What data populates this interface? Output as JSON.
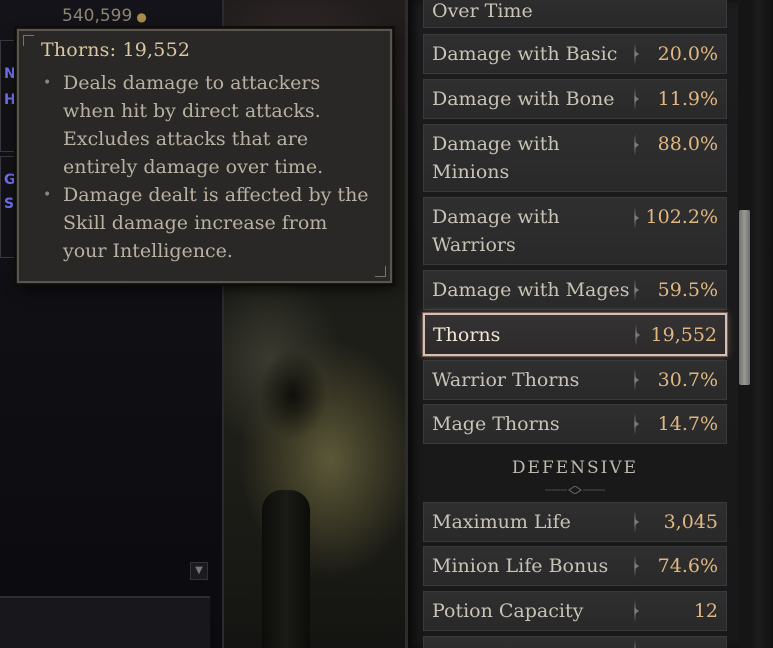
{
  "left_panel": {
    "gold_amount": "540,599",
    "fragment_a": "NG",
    "fragment_b": "HI",
    "fragment_c": "G",
    "fragment_d": "S"
  },
  "tooltip": {
    "title": "Thorns: 19,552",
    "bullets": [
      "Deals damage to attackers when hit by direct attacks. Excludes attacks that are entirely damage over time.",
      "Damage dealt is affected by the Skill damage increase from your Intelligence."
    ]
  },
  "stats": {
    "partial_top_label": "Over Time",
    "rows": [
      {
        "label": "Damage with Basic",
        "value": "20.0%"
      },
      {
        "label": "Damage with Bone",
        "value": "11.9%"
      },
      {
        "label": "Damage with Minions",
        "value": "88.0%"
      },
      {
        "label": "Damage with Warriors",
        "value": "102.2%"
      },
      {
        "label": "Damage with Mages",
        "value": "59.5%"
      },
      {
        "label": "Thorns",
        "value": "19,552"
      },
      {
        "label": "Warrior Thorns",
        "value": "30.7%"
      },
      {
        "label": "Mage Thorns",
        "value": "14.7%"
      }
    ],
    "section_defensive": "DEFENSIVE",
    "defensive_rows": [
      {
        "label": "Maximum Life",
        "value": "3,045"
      },
      {
        "label": "Minion Life Bonus",
        "value": "74.6%"
      },
      {
        "label": "Potion Capacity",
        "value": "12"
      }
    ]
  },
  "colors": {
    "value_gold": "#e0b781",
    "label_text": "#c9c3b5",
    "tooltip_title": "#d8c7a1",
    "selected_border": "#d6bfb2"
  }
}
